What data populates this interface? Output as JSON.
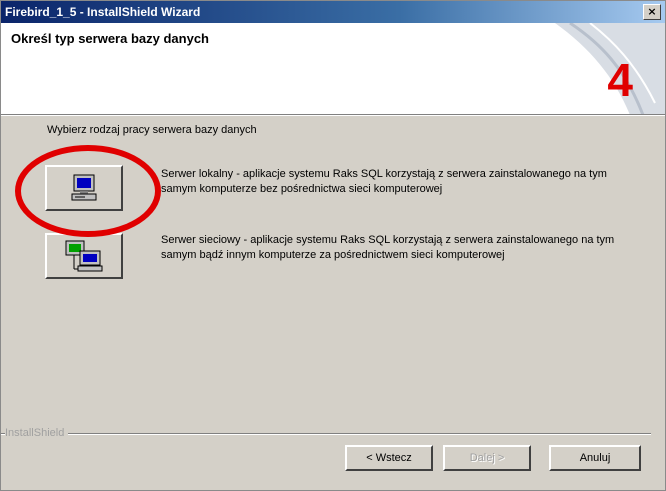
{
  "window": {
    "title": "Firebird_1_5 - InstallShield Wizard",
    "close_label": "×"
  },
  "header": {
    "title": "Określ typ serwera bazy danych",
    "step_badge": "4"
  },
  "main": {
    "prompt": "Wybierz rodzaj pracy serwera bazy danych",
    "options": [
      {
        "icon": "single-computer-icon",
        "text": "Serwer lokalny - aplikacje systemu Raks SQL korzystają z serwera zainstalowanego na tym samym komputerze bez pośrednictwa sieci komputerowej"
      },
      {
        "icon": "networked-computers-icon",
        "text": "Serwer sieciowy - aplikacje systemu Raks SQL korzystają z serwera zainstalowanego na tym samym bądź innym komputerze za pośrednictwem sieci komputerowej"
      }
    ]
  },
  "footer": {
    "brand": "InstallShield",
    "back_label": "< Wstecz",
    "next_label": "Dalej >",
    "cancel_label": "Anuluj"
  },
  "colors": {
    "highlight": "#e00000",
    "dialog_bg": "#d4d0c8",
    "titlebar": "#0a246a"
  }
}
